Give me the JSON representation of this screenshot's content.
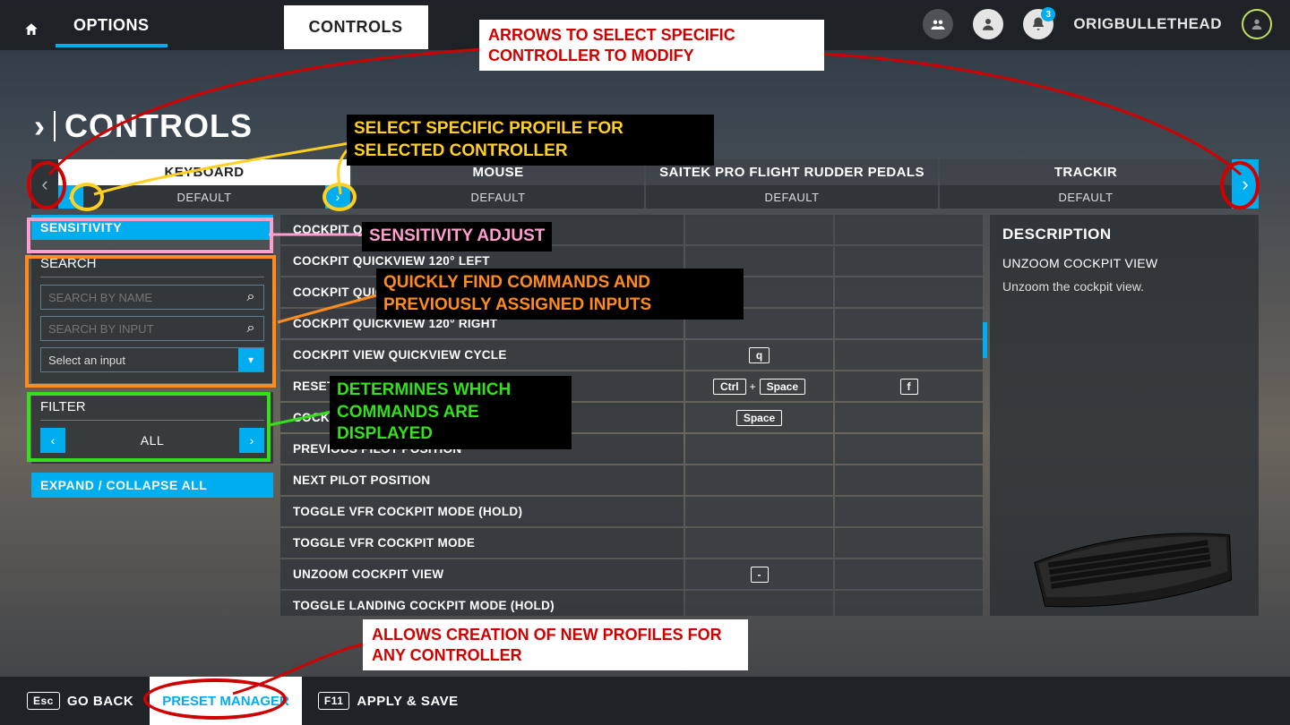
{
  "topbar": {
    "options_label": "OPTIONS",
    "controls_label": "CONTROLS",
    "username": "ORIGBULLETHEAD",
    "notif_count": "3"
  },
  "page_title": "CONTROLS",
  "controllers": [
    {
      "name": "KEYBOARD",
      "profile": "DEFAULT",
      "active": true
    },
    {
      "name": "MOUSE",
      "profile": "DEFAULT",
      "active": false
    },
    {
      "name": "SAITEK PRO FLIGHT RUDDER PEDALS",
      "profile": "DEFAULT",
      "active": false
    },
    {
      "name": "TRACKIR",
      "profile": "DEFAULT",
      "active": false
    }
  ],
  "left": {
    "sensitivity": "SENSITIVITY",
    "search_title": "SEARCH",
    "search_name_ph": "SEARCH BY NAME",
    "search_input_ph": "SEARCH BY INPUT",
    "select_input": "Select an input",
    "filter_title": "FILTER",
    "filter_value": "ALL",
    "expand": "EXPAND / COLLAPSE ALL"
  },
  "commands": [
    {
      "label": "COCKPIT QUICKVIEW 90° LEFT",
      "b1": [],
      "b2": []
    },
    {
      "label": "COCKPIT QUICKVIEW 120° LEFT",
      "b1": [],
      "b2": []
    },
    {
      "label": "COCKPIT QUICKVIEW 90° RIGHT",
      "b1": [],
      "b2": []
    },
    {
      "label": "COCKPIT QUICKVIEW 120° RIGHT",
      "b1": [],
      "b2": []
    },
    {
      "label": "COCKPIT VIEW QUICKVIEW CYCLE",
      "b1": [
        "q"
      ],
      "b2": []
    },
    {
      "label": "RESET COCKPIT VIEW",
      "b1": [
        "Ctrl",
        "+",
        "Space"
      ],
      "b2": [
        "f"
      ]
    },
    {
      "label": "COCKPIT VIEW RESET ZOOM",
      "b1": [
        "Space"
      ],
      "b2": []
    },
    {
      "label": "PREVIOUS PILOT POSITION",
      "b1": [],
      "b2": []
    },
    {
      "label": "NEXT PILOT POSITION",
      "b1": [],
      "b2": []
    },
    {
      "label": "TOGGLE VFR COCKPIT MODE (HOLD)",
      "b1": [],
      "b2": []
    },
    {
      "label": "TOGGLE VFR COCKPIT MODE",
      "b1": [],
      "b2": []
    },
    {
      "label": "UNZOOM COCKPIT VIEW",
      "b1": [
        "-"
      ],
      "b2": []
    },
    {
      "label": "TOGGLE LANDING COCKPIT MODE (HOLD)",
      "b1": [],
      "b2": []
    }
  ],
  "description": {
    "heading": "DESCRIPTION",
    "title": "UNZOOM COCKPIT VIEW",
    "body": "Unzoom the cockpit view."
  },
  "footer": {
    "go_back_key": "Esc",
    "go_back": "GO BACK",
    "preset": "PRESET MANAGER",
    "apply_key": "F11",
    "apply": "APPLY & SAVE"
  },
  "annotations": {
    "arrows_box": "ARROWS TO SELECT SPECIFIC CONTROLLER TO MODIFY",
    "profile_box": "SELECT SPECIFIC PROFILE FOR SELECTED CONTROLLER",
    "sensitivity_box": "SENSITIVITY ADJUST",
    "search_box": "QUICKLY FIND COMMANDS AND PREVIOUSLY ASSIGNED INPUTS",
    "filter_box": "DETERMINES WHICH COMMANDS ARE DISPLAYED",
    "preset_box": "ALLOWS CREATION OF NEW PROFILES FOR ANY CONTROLLER"
  }
}
